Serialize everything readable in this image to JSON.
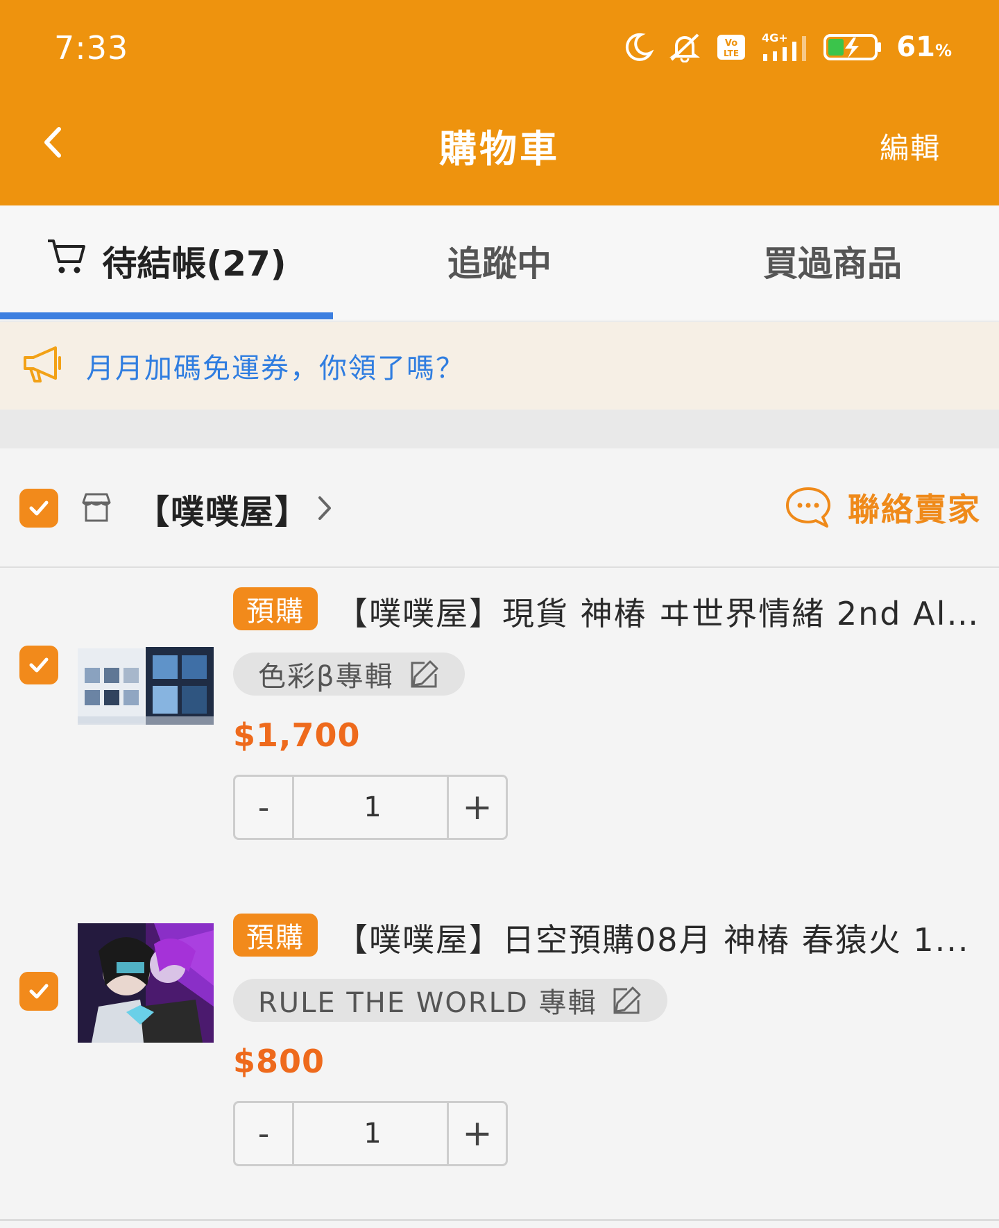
{
  "status_bar": {
    "time": "7:33",
    "network": "4G+",
    "volte": "Vo LTE",
    "battery_percent": "61",
    "battery_unit": "%",
    "icons": [
      "moon-icon",
      "mute-icon",
      "volte-icon",
      "signal-icon",
      "battery-charging-icon"
    ]
  },
  "nav": {
    "title": "購物車",
    "edit_label": "編輯",
    "back_icon": "chevron-left-icon"
  },
  "tabs": [
    {
      "label": "待結帳(27)",
      "active": true,
      "icon": "cart-icon"
    },
    {
      "label": "追蹤中",
      "active": false
    },
    {
      "label": "買過商品",
      "active": false
    }
  ],
  "banner": {
    "icon": "megaphone-icon",
    "text": "月月加碼免運券，你領了嗎？"
  },
  "shop": {
    "checked": true,
    "name": "【噗噗屋】",
    "contact_label": "聯絡賣家",
    "icons": [
      "store-icon",
      "chevron-right-icon",
      "chat-bubble-icon"
    ]
  },
  "items": [
    {
      "checked": true,
      "tag": "預購",
      "title": "【噗噗屋】現貨 神椿 ヰ世界情緒 2nd Al...",
      "variant": "色彩β專輯",
      "price": "$1,700",
      "quantity": "1",
      "minus_label": "-",
      "plus_label": "+"
    },
    {
      "checked": true,
      "tag": "預購",
      "title": "【噗噗屋】日空預購08月 神椿 春猿火 1...",
      "variant": "RULE THE WORLD 專輯",
      "price": "$800",
      "quantity": "1",
      "minus_label": "-",
      "plus_label": "+"
    }
  ],
  "colors": {
    "header": "#ee930e",
    "accent": "#f28a1b",
    "price": "#ee6a1c",
    "link_blue": "#2f7de0",
    "tab_underline": "#3d7fe0"
  }
}
